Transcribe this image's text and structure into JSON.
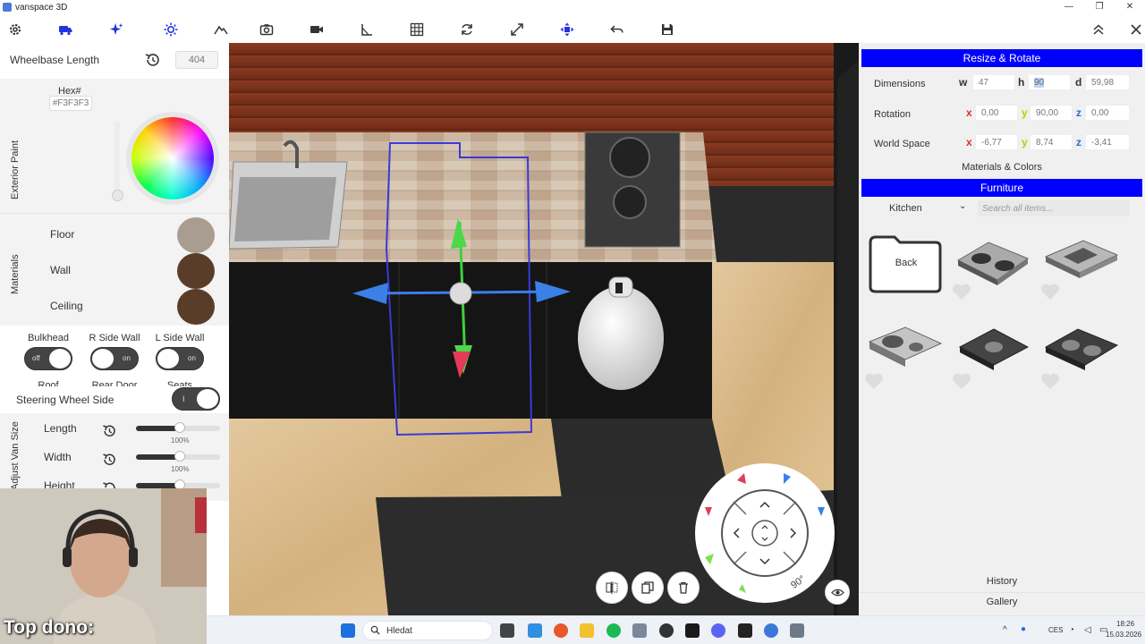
{
  "window": {
    "title": "vanspace 3D",
    "controls": [
      "—",
      "❐",
      "✕"
    ]
  },
  "toolbar": {
    "icons": [
      "gear-icon",
      "van-icon",
      "sparkle-icon",
      "sun-icon",
      "terrain-icon",
      "camera-icon",
      "video-icon",
      "ruler-angle-icon",
      "grid-icon",
      "rotate-icon",
      "expand-icon",
      "move-icon",
      "undo-icon",
      "save-icon"
    ],
    "right_icons": [
      "collapse-up-icon",
      "close-icon"
    ]
  },
  "left": {
    "wheelbase": {
      "label": "Wheelbase Length",
      "value": "404"
    },
    "exterior": {
      "section_label": "Exterior Paint",
      "hex_label": "Hex#",
      "hex_value": "#F3F3F3"
    },
    "materials": {
      "section_label": "Materials",
      "items": [
        {
          "label": "Floor",
          "color": "#a99d91"
        },
        {
          "label": "Wall",
          "color": "#5a3d29"
        },
        {
          "label": "Ceiling",
          "color": "#5a3d29"
        }
      ]
    },
    "toggles": [
      {
        "label": "Bulkhead",
        "state": "off"
      },
      {
        "label": "R Side Wall",
        "state": "on"
      },
      {
        "label": "L Side Wall",
        "state": "on"
      },
      {
        "label": "Roof",
        "state": "on"
      },
      {
        "label": "Rear Door",
        "state": "on"
      },
      {
        "label": "Seats",
        "state": "off"
      }
    ],
    "steering": {
      "label": "Steering Wheel Side",
      "state": "I"
    },
    "van_size": {
      "section_label": "Adjust Van Size",
      "sliders": [
        {
          "label": "Length",
          "value": "100%",
          "fraction": 0.52
        },
        {
          "label": "Width",
          "value": "100%",
          "fraction": 0.52
        },
        {
          "label": "Height",
          "value": "",
          "fraction": 0.52
        }
      ]
    }
  },
  "right": {
    "resize_header": "Resize & Rotate",
    "dimensions": {
      "label": "Dimensions",
      "w_label": "w",
      "w": "47",
      "h_label": "h",
      "h": "90",
      "d_label": "d",
      "d": "59,98"
    },
    "rotation": {
      "label": "Rotation",
      "x": "0,00",
      "y": "90,00",
      "z": "0,00"
    },
    "world": {
      "label": "World Space",
      "x": "-6,77",
      "y": "8,74",
      "z": "-3,41"
    },
    "axis_labels": {
      "x": "x",
      "y": "y",
      "z": "z"
    },
    "materials_link": "Materials & Colors",
    "furniture_header": "Furniture",
    "category": "Kitchen",
    "search_placeholder": "Search all items...",
    "back_label": "Back",
    "history_label": "History",
    "gallery_label": "Gallery"
  },
  "gizmo": {
    "rotate_label": "90°"
  },
  "webcam": {
    "caption": "Top dono:"
  },
  "taskbar": {
    "search_label": "Hledat",
    "lang": "CES",
    "time": "18:26",
    "date": "15.03.2026"
  }
}
